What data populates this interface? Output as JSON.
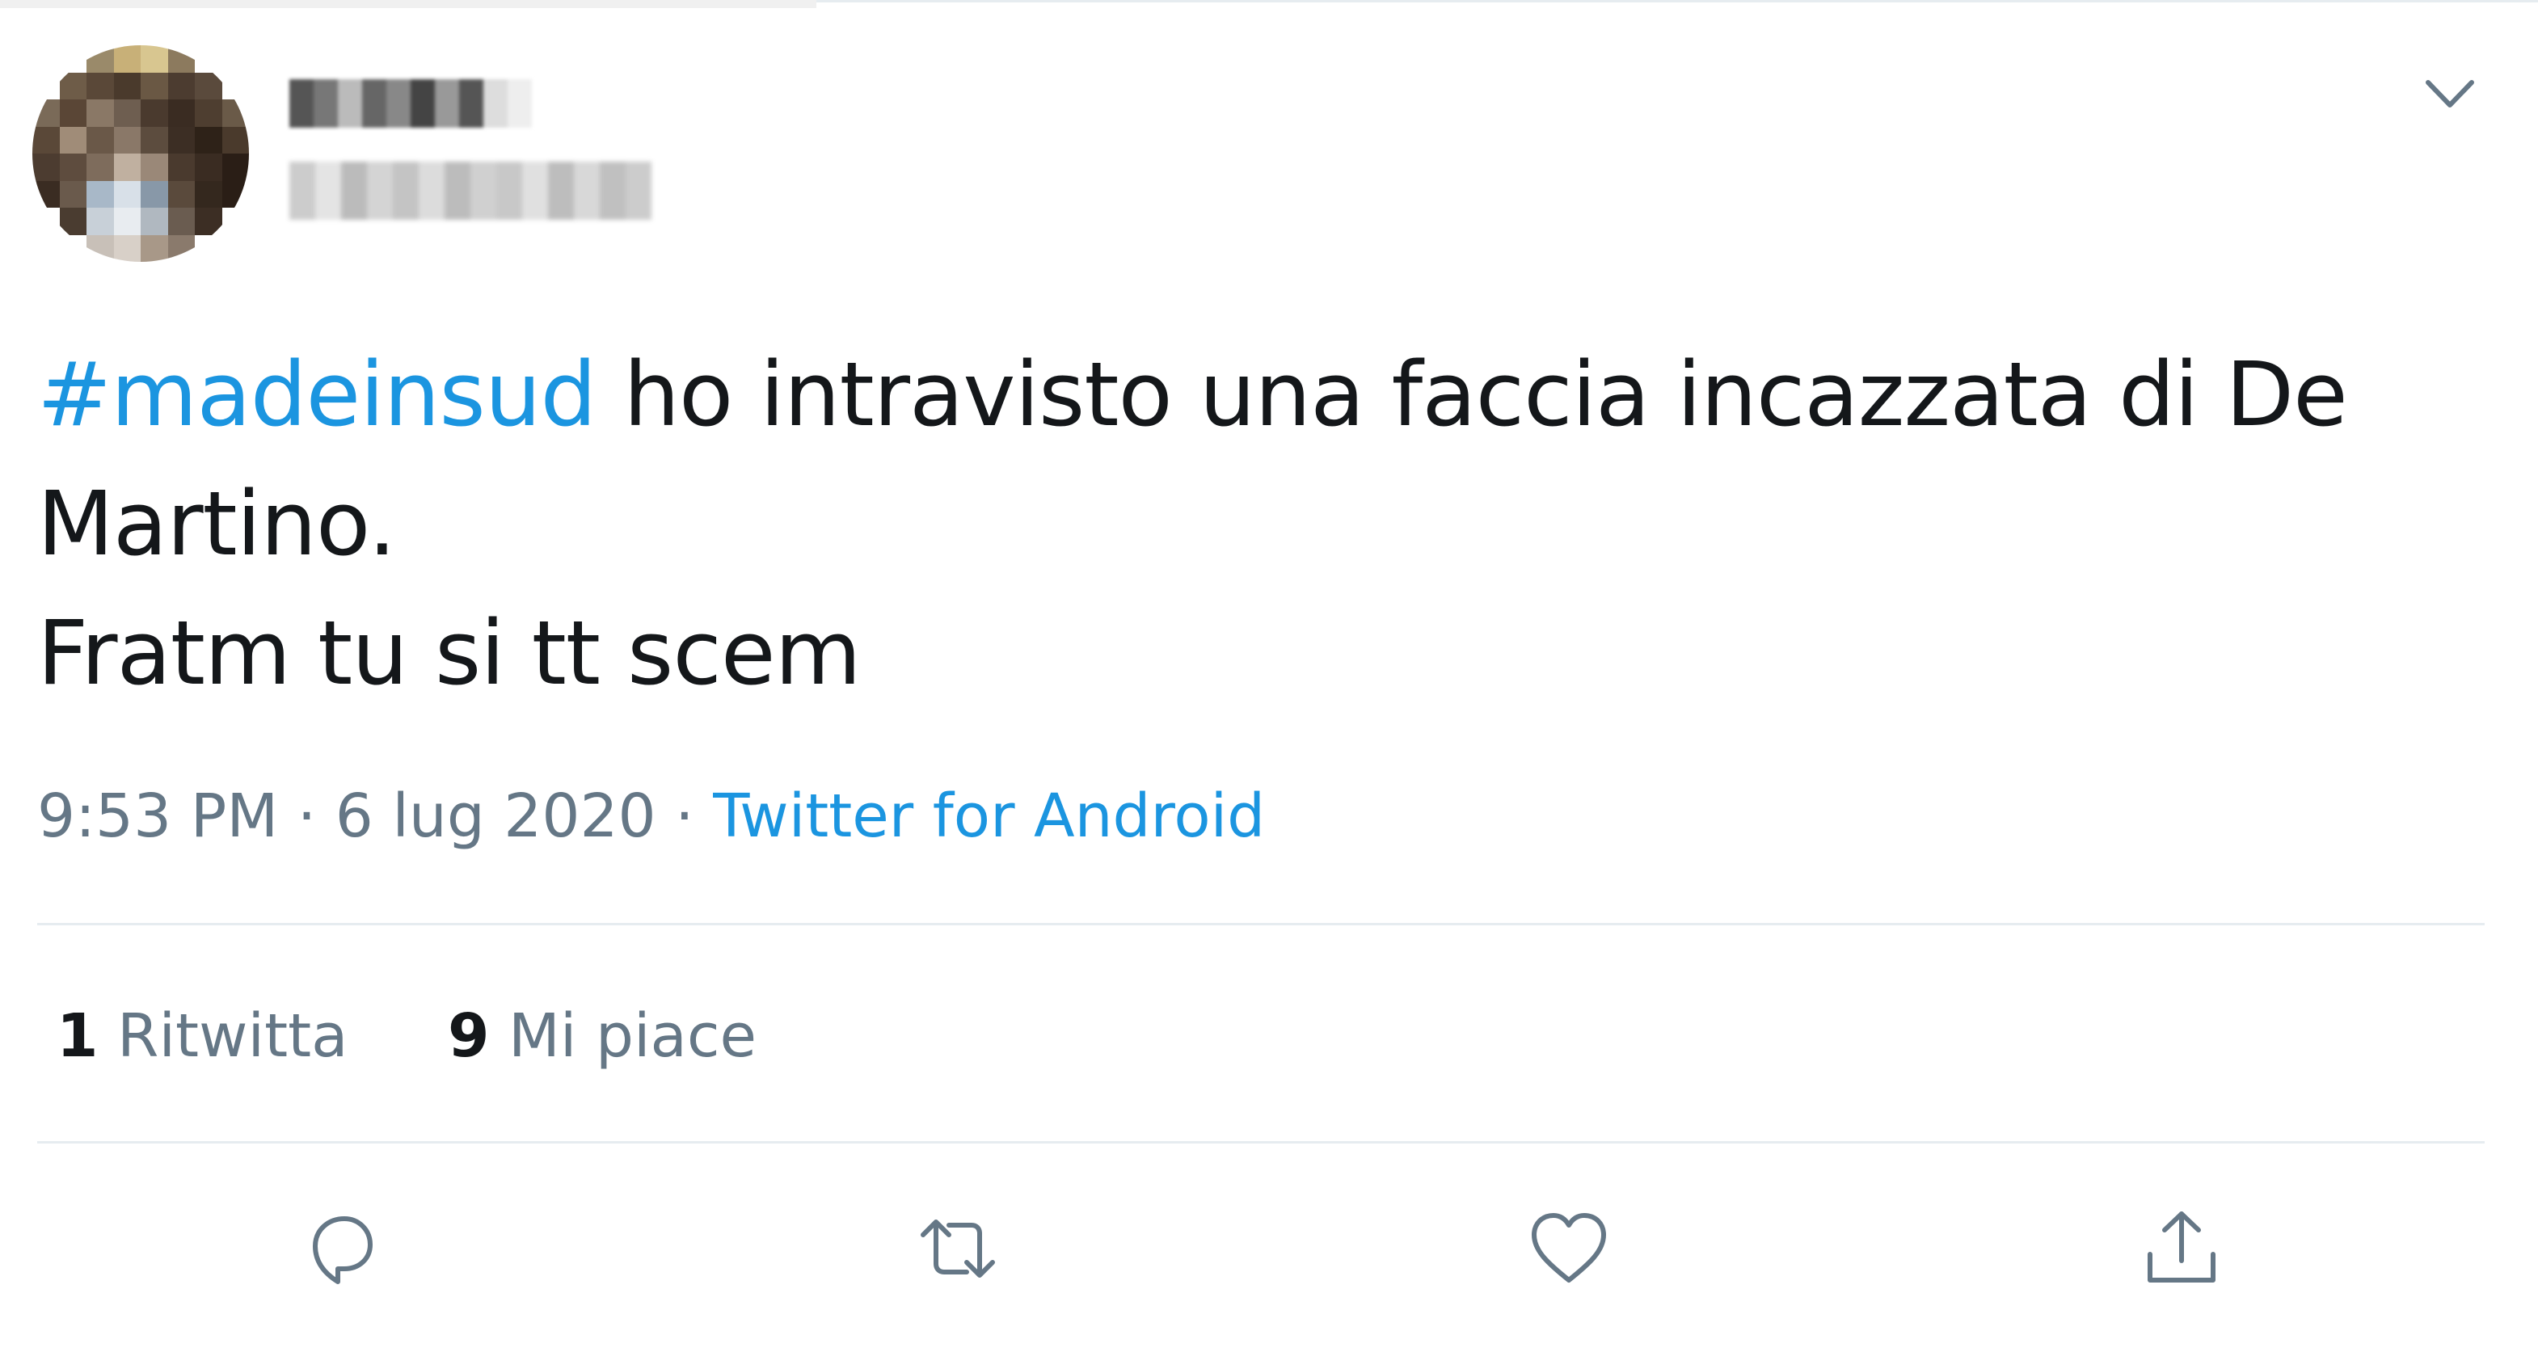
{
  "tweet": {
    "hashtag": "#madeinsud",
    "text_line1": " ho intravisto una faccia incazzata di De",
    "text_line2": "Martino.",
    "text_line3": "Fratm tu si tt scem",
    "time": "9:53 PM",
    "sep1": " · ",
    "date": "6 lug 2020",
    "sep2": " · ",
    "source": "Twitter for Android"
  },
  "stats": {
    "retweet_count": "1",
    "retweet_label": "Ritwitta",
    "like_count": "9",
    "like_label": "Mi piace"
  },
  "icons": {
    "menu": "chevron-down-icon",
    "reply": "reply-icon",
    "retweet": "retweet-icon",
    "like": "heart-icon",
    "share": "share-icon"
  },
  "colors": {
    "accent": "#1b95e0",
    "text": "#14171a",
    "secondary": "#657786",
    "divider": "#e6ecf0"
  }
}
